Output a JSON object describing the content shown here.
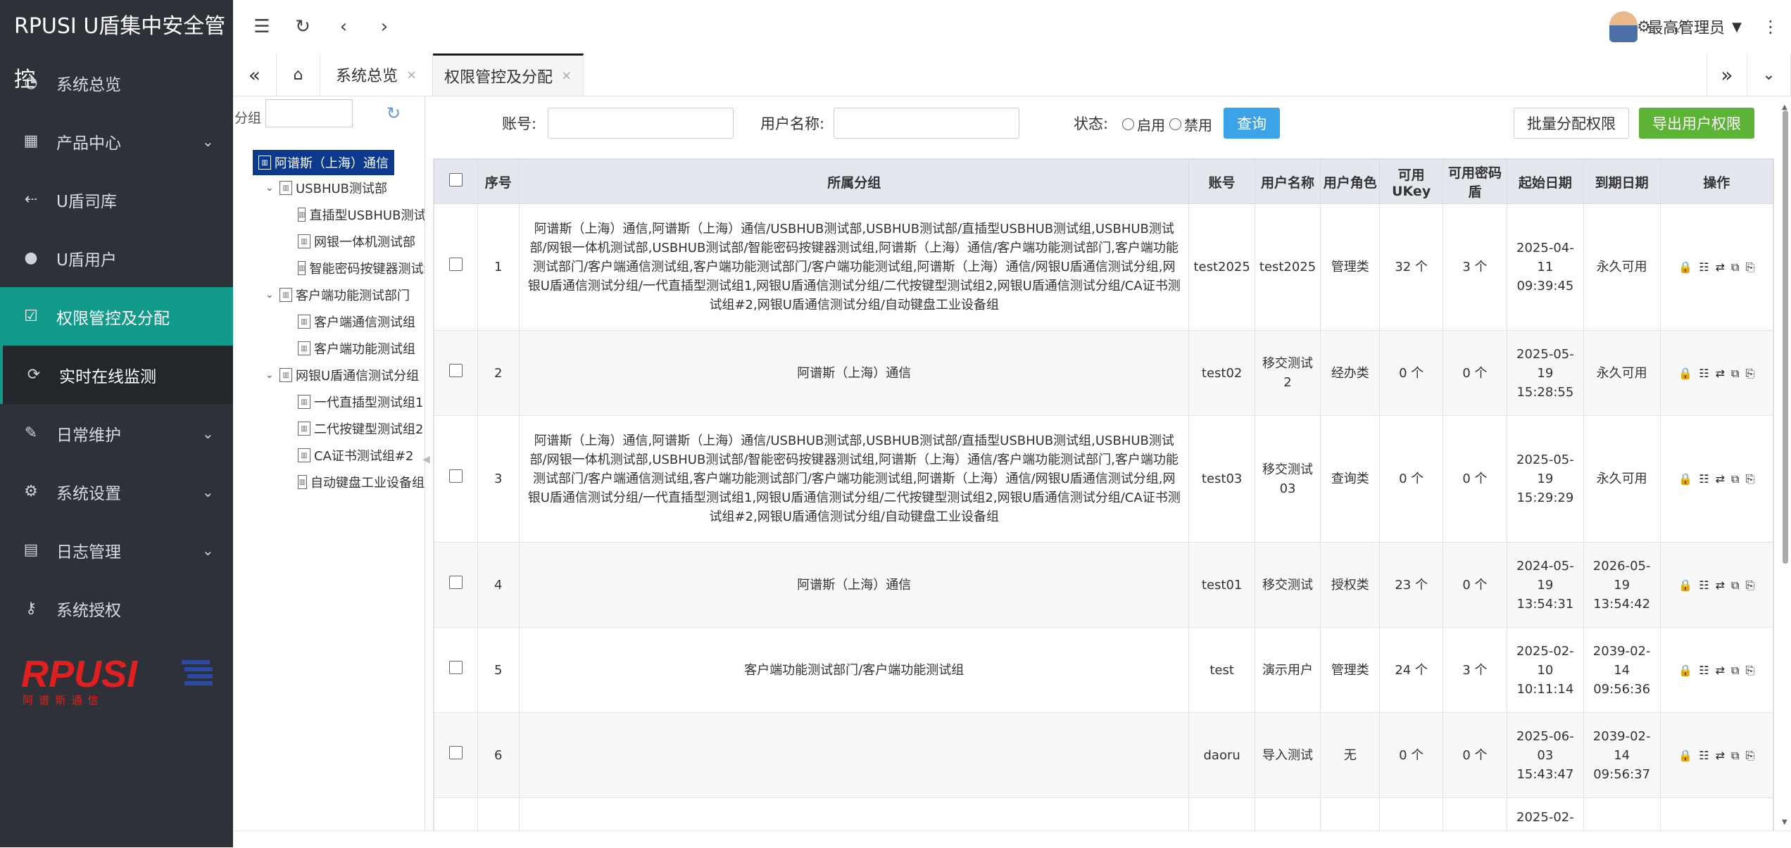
{
  "app": {
    "title": "RPUSI U盾集中安全管控"
  },
  "sidebar": {
    "items": [
      {
        "label": "系统总览",
        "icon": "dashboard-icon"
      },
      {
        "label": "产品中心",
        "icon": "grid-icon"
      },
      {
        "label": "U盾司库",
        "icon": "usb-icon"
      },
      {
        "label": "U盾用户",
        "icon": "user-icon"
      },
      {
        "label": "权限管控及分配",
        "icon": "checkbox-icon"
      },
      {
        "label": "实时在线监测",
        "icon": "refresh-icon"
      },
      {
        "label": "日常维护",
        "icon": "wrench-icon"
      },
      {
        "label": "系统设置",
        "icon": "gears-icon"
      },
      {
        "label": "日志管理",
        "icon": "log-icon"
      },
      {
        "label": "系统授权",
        "icon": "key-icon"
      }
    ],
    "logo": {
      "text": "RPUSI",
      "subtext": "阿 谱 斯 通 信"
    }
  },
  "topbar": {
    "user_name": "最高管理员"
  },
  "tabs": [
    {
      "label": "系统总览"
    },
    {
      "label": "权限管控及分配"
    }
  ],
  "tree": {
    "search_label": "分组",
    "nodes": [
      {
        "label": "阿谱斯（上海）通信"
      },
      {
        "label": "USBHUB测试部"
      },
      {
        "label": "直插型USBHUB测试组"
      },
      {
        "label": "网银一体机测试部"
      },
      {
        "label": "智能密码按键器测试组"
      },
      {
        "label": "客户端功能测试部门"
      },
      {
        "label": "客户端通信测试组"
      },
      {
        "label": "客户端功能测试组"
      },
      {
        "label": "网银U盾通信测试分组"
      },
      {
        "label": "一代直插型测试组1"
      },
      {
        "label": "二代按键型测试组2"
      },
      {
        "label": "CA证书测试组#2"
      },
      {
        "label": "自动键盘工业设备组"
      }
    ]
  },
  "filter": {
    "account_label": "账号:",
    "username_label": "用户名称:",
    "status_label": "状态:",
    "enabled_label": "启用",
    "disabled_label": "禁用",
    "query_button": "查询",
    "batch_button": "批量分配权限",
    "export_button": "导出用户权限"
  },
  "table": {
    "columns": [
      "序号",
      "所属分组",
      "账号",
      "用户名称",
      "用户角色",
      "可用UKey",
      "可用密码盾",
      "起始日期",
      "到期日期",
      "操作"
    ],
    "rows": [
      {
        "no": "1",
        "group": "阿谱斯（上海）通信,阿谱斯（上海）通信/USBHUB测试部,USBHUB测试部/直插型USBHUB测试组,USBHUB测试部/网银一体机测试部,USBHUB测试部/智能密码按键器测试组,阿谱斯（上海）通信/客户端功能测试部门,客户端功能测试部门/客户端通信测试组,客户端功能测试部门/客户端功能测试组,阿谱斯（上海）通信/网银U盾通信测试分组,网银U盾通信测试分组/一代直插型测试组1,网银U盾通信测试分组/二代按键型测试组2,网银U盾通信测试分组/CA证书测试组#2,网银U盾通信测试分组/自动键盘工业设备组",
        "account": "test2025",
        "name": "test2025",
        "role": "管理类",
        "ukey": "32 个",
        "pwd": "3 个",
        "start": "2025-04-11 09:39:45",
        "end": "永久可用"
      },
      {
        "no": "2",
        "group": "阿谱斯（上海）通信",
        "account": "test02",
        "name": "移交测试2",
        "role": "经办类",
        "ukey": "0 个",
        "pwd": "0 个",
        "start": "2025-05-19 15:28:55",
        "end": "永久可用"
      },
      {
        "no": "3",
        "group": "阿谱斯（上海）通信,阿谱斯（上海）通信/USBHUB测试部,USBHUB测试部/直插型USBHUB测试组,USBHUB测试部/网银一体机测试部,USBHUB测试部/智能密码按键器测试组,阿谱斯（上海）通信/客户端功能测试部门,客户端功能测试部门/客户端通信测试组,客户端功能测试部门/客户端功能测试组,阿谱斯（上海）通信/网银U盾通信测试分组,网银U盾通信测试分组/一代直插型测试组1,网银U盾通信测试分组/二代按键型测试组2,网银U盾通信测试分组/CA证书测试组#2,网银U盾通信测试分组/自动键盘工业设备组",
        "account": "test03",
        "name": "移交测试03",
        "role": "查询类",
        "ukey": "0 个",
        "pwd": "0 个",
        "start": "2025-05-19 15:29:29",
        "end": "永久可用"
      },
      {
        "no": "4",
        "group": "阿谱斯（上海）通信",
        "account": "test01",
        "name": "移交测试",
        "role": "授权类",
        "ukey": "23 个",
        "pwd": "0 个",
        "start": "2024-05-19 13:54:31",
        "end": "2026-05-19 13:54:42"
      },
      {
        "no": "5",
        "group": "客户端功能测试部门/客户端功能测试组",
        "account": "test",
        "name": "演示用户",
        "role": "管理类",
        "ukey": "24 个",
        "pwd": "3 个",
        "start": "2025-02-10 10:11:14",
        "end": "2039-02-14 09:56:36"
      },
      {
        "no": "6",
        "group": "",
        "account": "daoru",
        "name": "导入测试",
        "role": "无",
        "ukey": "0 个",
        "pwd": "0 个",
        "start": "2025-06-03 15:43:47",
        "end": "2039-02-14 09:56:37"
      },
      {
        "no": "",
        "group": "",
        "account": "",
        "name": "",
        "role": "",
        "ukey": "",
        "pwd": "",
        "start": "2025-02-",
        "end": ""
      }
    ]
  }
}
